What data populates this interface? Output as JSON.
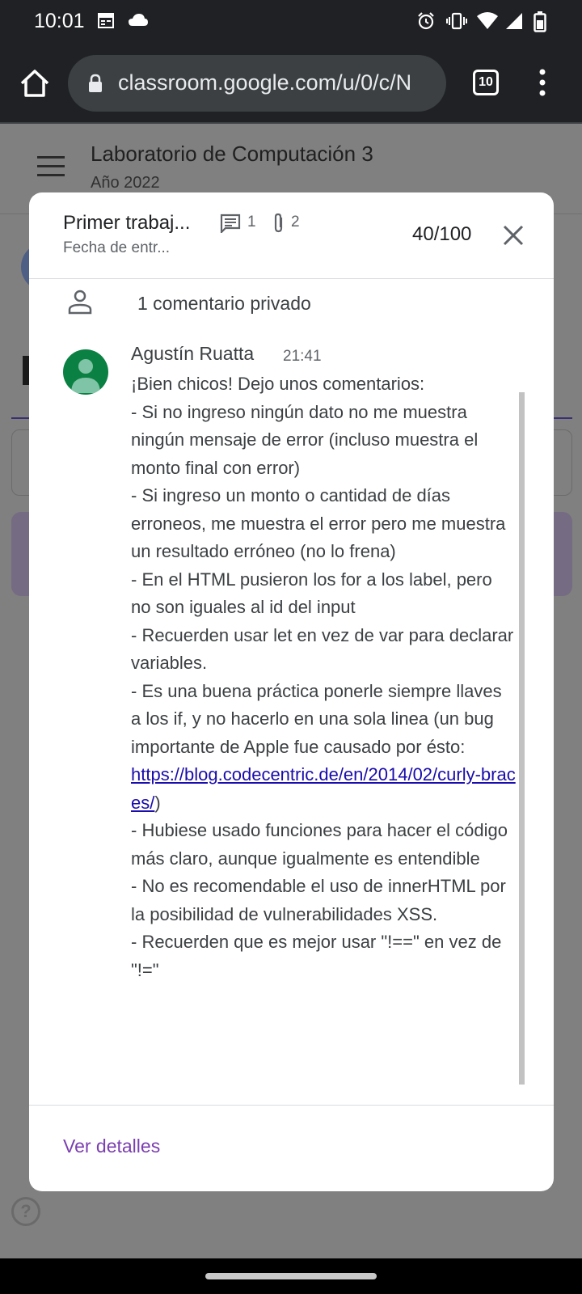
{
  "status_bar": {
    "time": "10:01",
    "icons": [
      "calendar-icon",
      "cloud-icon",
      "alarm-icon",
      "vibrate-icon",
      "wifi-icon",
      "signal-icon",
      "battery-icon"
    ]
  },
  "browser": {
    "url": "classroom.google.com/u/0/c/N",
    "tab_count": "10",
    "icons": [
      "home-icon",
      "lock-icon",
      "menu-dots-icon"
    ]
  },
  "background_page": {
    "course_title": "Laboratorio de Computación 3",
    "course_subtitle": "Año 2022",
    "help_glyph": "?"
  },
  "dialog": {
    "assignment_title": "Primer trabaj...",
    "due_date": "Fecha de entr...",
    "comment_count": "1",
    "attachment_count": "2",
    "score": "40/100",
    "private_comments_label": "1 comentario privado",
    "comment": {
      "author": "Agustín Ruatta",
      "time": "21:41",
      "lines": [
        "¡Bien chicos! Dejo unos comentarios:",
        "- Si no ingreso ningún dato no me muestra ningún mensaje de error (incluso muestra el monto final con error)",
        "- Si ingreso un monto o cantidad de días erroneos, me muestra el error pero me muestra un resultado erróneo (no lo frena)",
        "- En el HTML pusieron los for a los label, pero no son iguales al id del input",
        "- Recuerden usar let en vez de var para declarar variables.",
        "- Es una buena práctica ponerle siempre llaves a los if, y no hacerlo en una sola linea (un bug importante de Apple fue causado por ésto:"
      ],
      "link": "https://blog.codecentric.de/en/2014/02/curly-braces/",
      "link_suffix": ")",
      "lines_after": [
        "- Hubiese usado funciones para hacer el código más claro, aunque igualmente es entendible",
        "- No es recomendable el uso de innerHTML por la posibilidad de vulnerabilidades XSS.",
        "- Recuerden que es mejor usar \"!==\" en vez de \"!=\""
      ]
    },
    "footer_link": "Ver detalles"
  },
  "colors": {
    "accent_purple": "#7b3fb0",
    "link_blue": "#1a0dab",
    "avatar_green": "#0b8043",
    "system_bar": "#202124"
  }
}
